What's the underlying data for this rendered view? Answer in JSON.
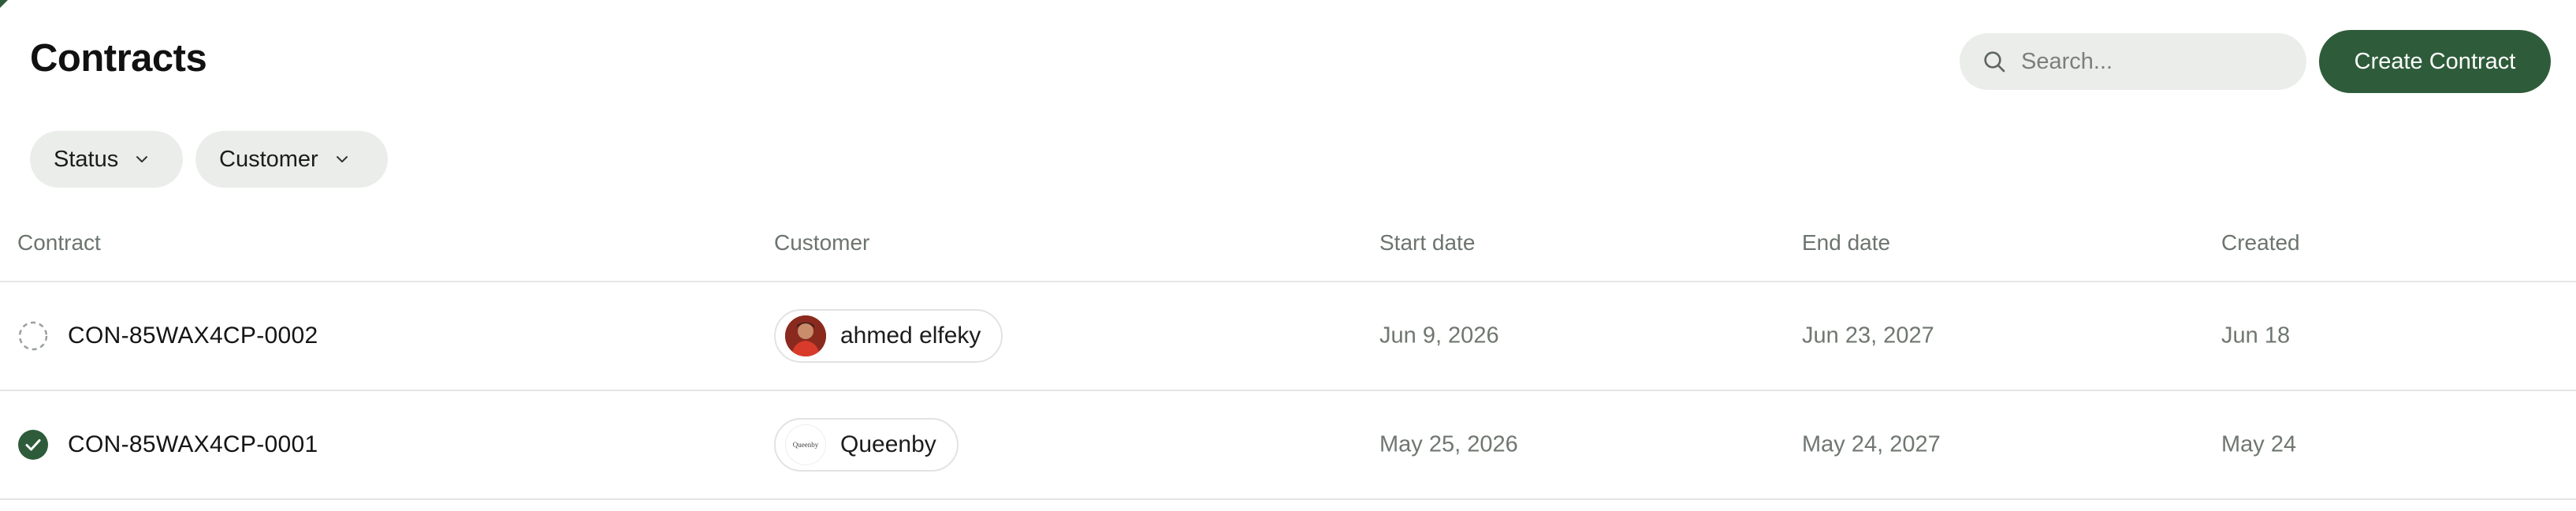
{
  "page": {
    "title": "Contracts"
  },
  "search": {
    "placeholder": "Search...",
    "icon": "search-icon"
  },
  "actions": {
    "create_label": "Create Contract"
  },
  "filters": [
    {
      "label": "Status",
      "icon": "chevron-down-icon"
    },
    {
      "label": "Customer",
      "icon": "chevron-down-icon"
    }
  ],
  "table": {
    "columns": [
      "Contract",
      "Customer",
      "Start date",
      "End date",
      "Created"
    ],
    "rows": [
      {
        "status": "draft",
        "status_icon": "dashed-circle-icon",
        "contract": "CON-85WAX4CP-0002",
        "customer": "ahmed elfeky",
        "customer_avatar": "photo-avatar",
        "start_date": "Jun 9, 2026",
        "end_date": "Jun 23, 2027",
        "created": "Jun 18"
      },
      {
        "status": "active",
        "status_icon": "check-circle-icon",
        "contract": "CON-85WAX4CP-0001",
        "customer": "Queenby",
        "customer_avatar": "logo-avatar",
        "customer_logo_text": "Queenby",
        "start_date": "May 25, 2026",
        "end_date": "May 24, 2027",
        "created": "May 24"
      }
    ]
  },
  "colors": {
    "accent": "#2e5c3a",
    "chip_bg": "#ebedeb",
    "muted_text": "#6f7770",
    "divider": "#e4e6e4"
  }
}
